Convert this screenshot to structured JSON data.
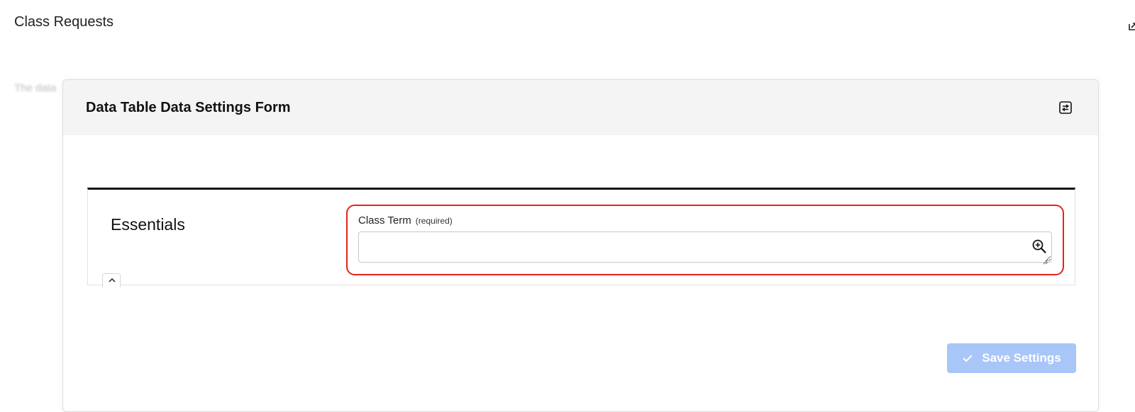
{
  "page": {
    "title": "Class Requests",
    "background_text": "The data"
  },
  "modal": {
    "title": "Data Table Data Settings Form",
    "header_icon": "settings-sliders-icon",
    "section": {
      "title": "Essentials",
      "collapse_icon": "chevron-up-icon"
    },
    "field": {
      "label": "Class Term",
      "required_text": "(required)",
      "value": "",
      "placeholder": "",
      "icon": "zoom-in-icon",
      "highlight_color": "#e1251b"
    },
    "save_button": {
      "label": "Save Settings",
      "icon": "check-icon",
      "color": "#a8c6f8"
    }
  }
}
